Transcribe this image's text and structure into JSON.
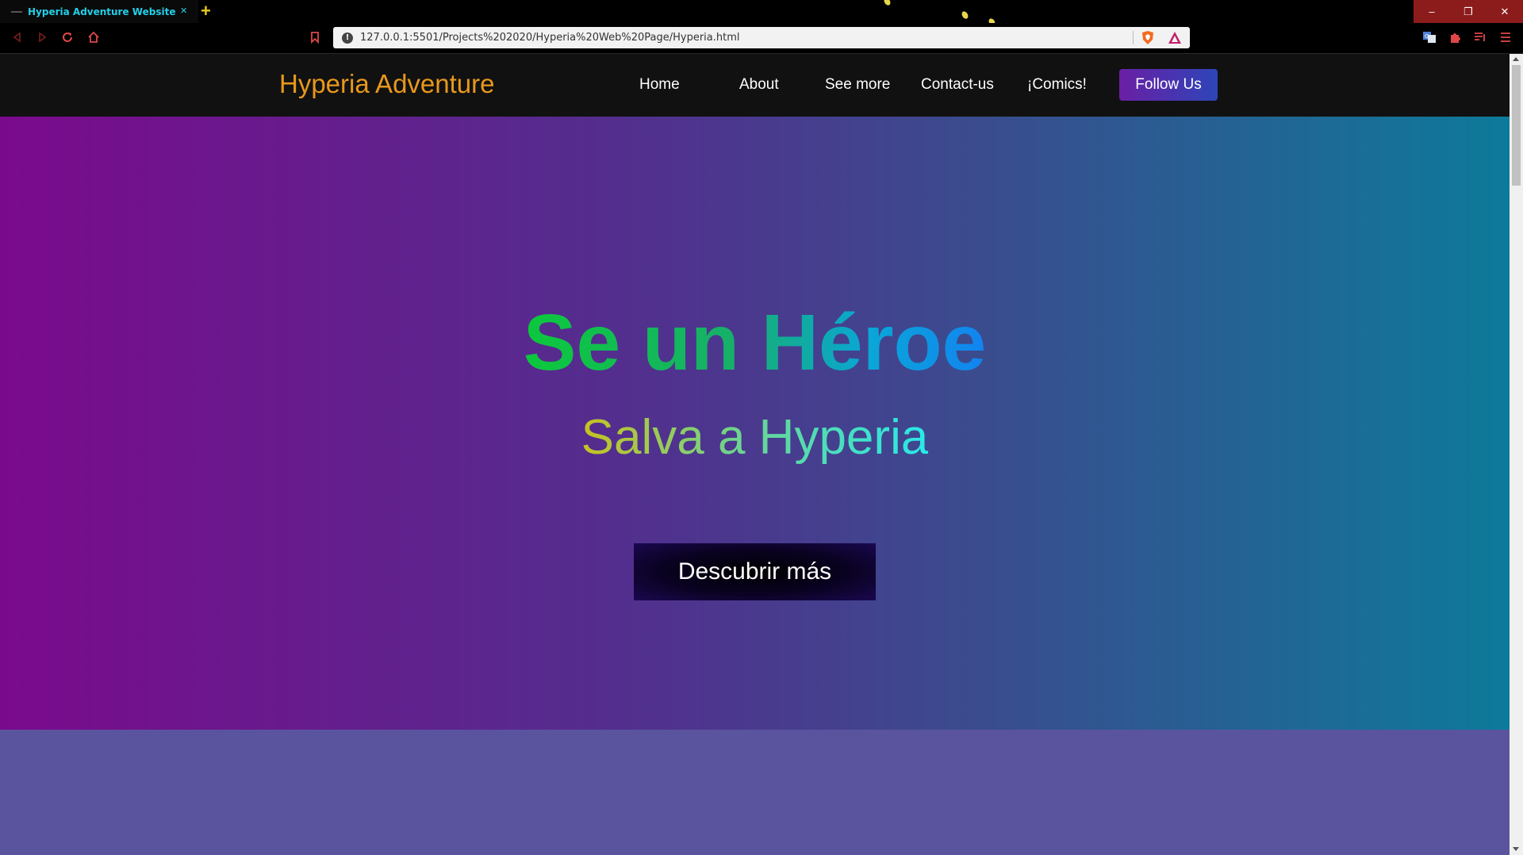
{
  "browser": {
    "tab_title": "Hyperia Adventure Website",
    "tab_close": "×",
    "new_tab": "+",
    "url": "127.0.0.1:5501/Projects%202020/Hyperia%20Web%20Page/Hyperia.html",
    "url_info": "!",
    "window_controls": {
      "minimize": "–",
      "restore": "❐",
      "close": "✕"
    },
    "icons": [
      "back-icon",
      "forward-icon",
      "reload-icon",
      "home-icon",
      "bookmark-icon",
      "brave-shield-icon",
      "brave-rewards-icon",
      "translate-icon",
      "extensions-icon",
      "playlist-icon",
      "menu-icon"
    ]
  },
  "site": {
    "brand": "Hyperia Adventure",
    "nav": [
      "Home",
      "About",
      "See more",
      "Contact-us",
      "¡Comics!"
    ],
    "follow": "Follow Us"
  },
  "hero": {
    "title": "Se un Héroe",
    "subtitle": "Salva a Hyperia",
    "cta": "Descubrir más"
  },
  "colors": {
    "brand": "#e8981c",
    "hero_left": "#7a0a8c",
    "hero_right": "#0d7a9a",
    "section_below": "#5a549e",
    "follow_gradient_start": "#6a1fa5",
    "follow_gradient_end": "#2d45b8",
    "tab_text": "#22d0e8"
  }
}
